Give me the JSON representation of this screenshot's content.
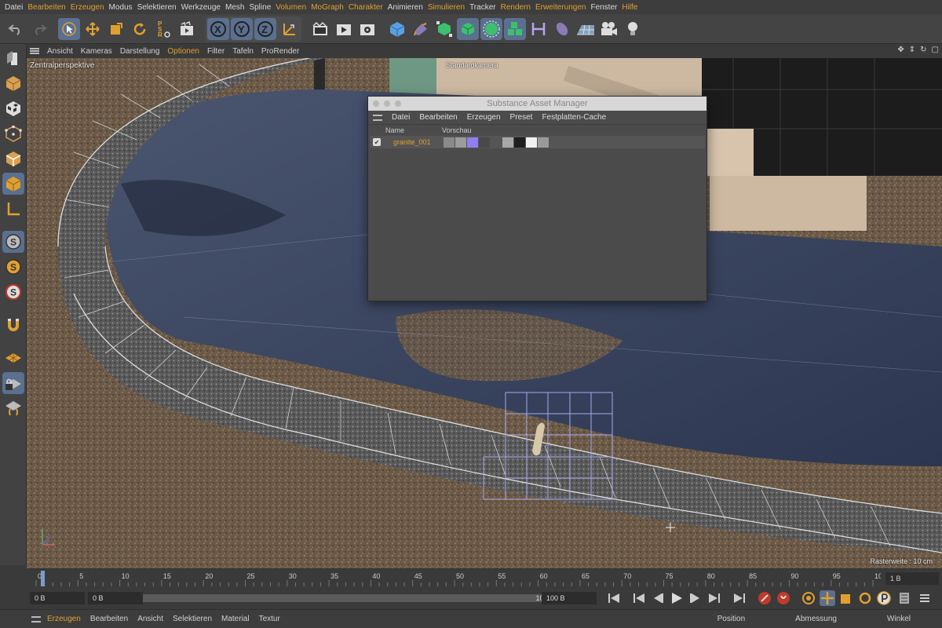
{
  "menubar": {
    "items": [
      {
        "label": "Datei",
        "accent": false
      },
      {
        "label": "Bearbeiten",
        "accent": true
      },
      {
        "label": "Erzeugen",
        "accent": true
      },
      {
        "label": "Modus",
        "accent": false
      },
      {
        "label": "Selektieren",
        "accent": false
      },
      {
        "label": "Werkzeuge",
        "accent": false
      },
      {
        "label": "Mesh",
        "accent": false
      },
      {
        "label": "Spline",
        "accent": false
      },
      {
        "label": "Volumen",
        "accent": true
      },
      {
        "label": "MoGraph",
        "accent": true
      },
      {
        "label": "Charakter",
        "accent": true
      },
      {
        "label": "Animieren",
        "accent": false
      },
      {
        "label": "Simulieren",
        "accent": true
      },
      {
        "label": "Tracker",
        "accent": false
      },
      {
        "label": "Rendern",
        "accent": true
      },
      {
        "label": "Erweiterungen",
        "accent": true
      },
      {
        "label": "Fenster",
        "accent": false
      },
      {
        "label": "Hilfe",
        "accent": true
      }
    ]
  },
  "toolbar": {
    "icons": [
      "undo-icon",
      "redo-icon",
      "select-cursor-icon",
      "move-icon",
      "scale-icon",
      "rotate-icon",
      "psr-icon",
      "recent-tools-icon",
      "x-axis-icon",
      "y-axis-icon",
      "z-axis-icon",
      "coordinate-system-icon",
      "render-view-icon",
      "render-picture-viewer-icon",
      "render-settings-icon",
      "cube-icon",
      "pen-icon",
      "subdivision-icon",
      "extrude-icon",
      "cloner-icon",
      "mograph-icon",
      "deformer-icon",
      "field-icon",
      "floor-icon",
      "camera-icon",
      "light-icon"
    ],
    "axis_labels": {
      "x": "X",
      "y": "Y",
      "z": "Z"
    },
    "psr_labels": {
      "p": "P",
      "s": "S",
      "r": "R"
    }
  },
  "leftbar": {
    "icons": [
      "model-mode-icon",
      "object-mode-icon",
      "texture-mode-icon",
      "point-mode-icon",
      "edge-mode-icon",
      "polygon-mode-icon",
      "uv-mode-icon",
      "snap-icon",
      "snap-settings-icon",
      "quantize-icon",
      "magnet-icon",
      "workplane-icon",
      "lock-workplane-icon",
      "enable-axis-icon"
    ],
    "snap_label": "S"
  },
  "viewport_menu": {
    "items": [
      {
        "label": "Ansicht",
        "accent": false
      },
      {
        "label": "Kameras",
        "accent": false
      },
      {
        "label": "Darstellung",
        "accent": false
      },
      {
        "label": "Optionen",
        "accent": true
      },
      {
        "label": "Filter",
        "accent": false
      },
      {
        "label": "Tafeln",
        "accent": false
      },
      {
        "label": "ProRender",
        "accent": false
      }
    ]
  },
  "viewport": {
    "perspective": "Zentralperspektive",
    "camera": "Standardkamera",
    "grid_spacing": "Rasterweite : 10 cm"
  },
  "dialog": {
    "title": "Substance Asset Manager",
    "menu": [
      "Datei",
      "Bearbeiten",
      "Erzeugen",
      "Preset",
      "Festplatten-Cache"
    ],
    "columns": {
      "name": "Name",
      "preview": "Vorschau"
    },
    "rows": [
      {
        "name": "granite_001",
        "checked": true,
        "check_glyph": "✔",
        "swatches": [
          "#8a8a8a",
          "#9b9b9b",
          "#8f7ff0",
          "#4a4a4a",
          "#555555",
          "#a8a8a8",
          "#1e1e1e",
          "#f2f2f2",
          "#9a9a9a"
        ]
      }
    ]
  },
  "timeline": {
    "ticks": [
      "0",
      "5",
      "10",
      "15",
      "20",
      "25",
      "30",
      "35",
      "40",
      "45",
      "50",
      "55",
      "60",
      "65",
      "70",
      "75",
      "80",
      "85",
      "90",
      "95",
      "100"
    ],
    "current_frame": "1 B"
  },
  "transport": {
    "start": "0 B",
    "current": "0 B",
    "end": "100 B",
    "max": "100 B"
  },
  "bottombar": {
    "left": [
      {
        "label": "Erzeugen",
        "accent": true
      },
      {
        "label": "Bearbeiten",
        "accent": false
      },
      {
        "label": "Ansicht",
        "accent": false
      },
      {
        "label": "Selektieren",
        "accent": false
      },
      {
        "label": "Material",
        "accent": false
      },
      {
        "label": "Textur",
        "accent": false
      }
    ],
    "right": [
      "Position",
      "Abmessung",
      "Winkel"
    ]
  },
  "colors": {
    "accent": "#e0a030",
    "active_button": "#5b6f8f",
    "panel": "#3d3d3d",
    "dialog_bg": "#4b4b4b"
  }
}
